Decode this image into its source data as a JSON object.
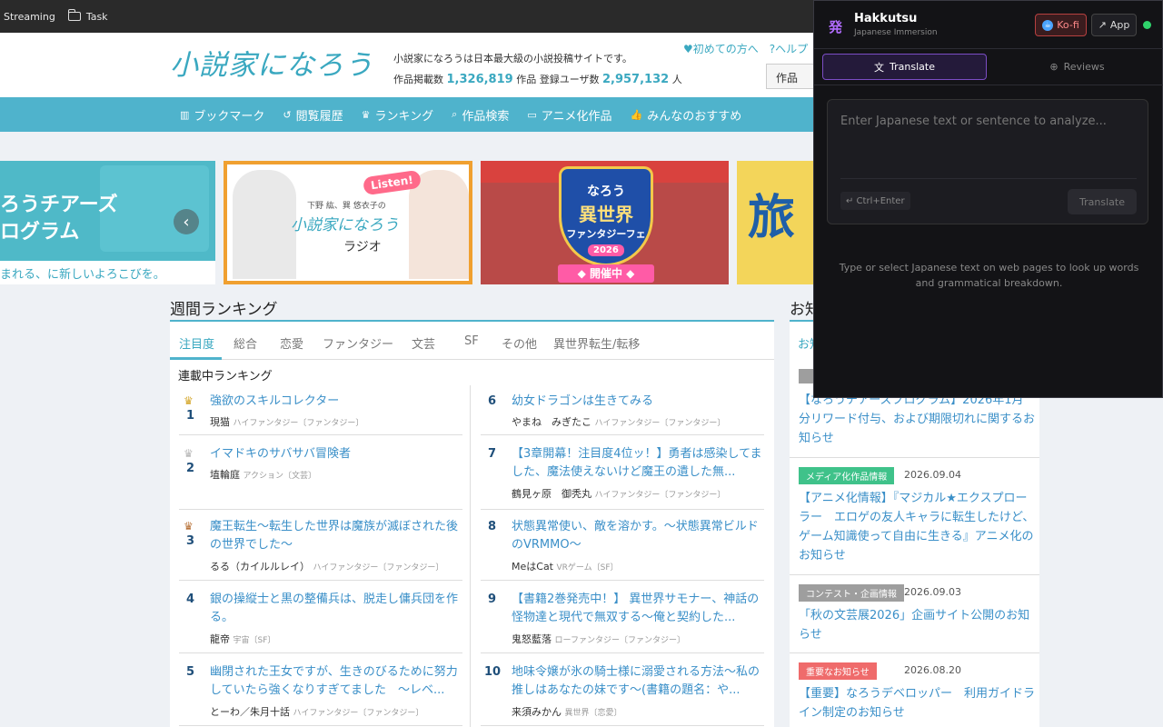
{
  "bookmarks": [
    {
      "label": "Streaming"
    },
    {
      "label": "Task"
    }
  ],
  "site": {
    "logo": "小説家になろう",
    "tagline": "小説家になろうは日本最大級の小説投稿サイトです。",
    "count_works_label": "作品掲載数",
    "count_works": "1,326,819",
    "count_works_unit": "作品",
    "count_users_label": "登録ユーザ数",
    "count_users": "2,957,132",
    "count_users_unit": "人",
    "link_first": "初めての方へ",
    "link_help": "ヘルプ",
    "search_select": "作品"
  },
  "nav": [
    {
      "icon": "▥",
      "label": "ブックマーク"
    },
    {
      "icon": "↺",
      "label": "閲覧履歴"
    },
    {
      "icon": "♛",
      "label": "ランキング"
    },
    {
      "icon": "⌕",
      "label": "作品検索"
    },
    {
      "icon": "▭",
      "label": "アニメ化作品"
    },
    {
      "icon": "👍",
      "label": "みんなのおすすめ"
    }
  ],
  "banners": {
    "b1_line1": "ろうチアーズ",
    "b1_line2": "ログラム",
    "b1_line3": "まれる、に新しいよろこびを。",
    "b2_listen": "Listen!",
    "b2_cap1": "下野 紘、巽 悠衣子の",
    "b2_cap2": "小説家になろう",
    "b2_cap3": "ラジオ",
    "b3_line1": "なろう",
    "b3_line2": "異世界",
    "b3_line3": "ファンタジーフェス!",
    "b3_year": "2026",
    "b3_status": "◆ 開催中 ◆",
    "b4_text": "旅"
  },
  "ranking": {
    "title": "週間ランキング",
    "tabs": [
      "注目度",
      "総合",
      "恋愛",
      "ファンタジー",
      "文芸",
      "SF",
      "その他",
      "異世界転生/転移"
    ],
    "subtitle": "連載中ランキング",
    "items": [
      {
        "rank": "1",
        "title": "強欲のスキルコレクター",
        "author": "現猫",
        "genre": "ハイファンタジー〔ファンタジー〕"
      },
      {
        "rank": "2",
        "title": "イマドキのサバサバ冒険者",
        "author": "埴輪庭",
        "genre": "アクション〔文芸〕"
      },
      {
        "rank": "3",
        "title": "魔王転生〜転生した世界は魔族が滅ぼされた後の世界でした〜",
        "author": "るる（カイルルレイ）",
        "genre": "ハイファンタジー〔ファンタジー〕"
      },
      {
        "rank": "4",
        "title": "銀の操縦士と黒の整備兵は、脱走し傭兵団を作る。",
        "author": "龍帝",
        "genre": "宇宙〔SF〕"
      },
      {
        "rank": "5",
        "title": "幽閉された王女ですが、生きのびるために努力していたら強くなりすぎてました　〜レベ...",
        "author": "とーわ／朱月十話",
        "genre": "ハイファンタジー〔ファンタジー〕"
      },
      {
        "rank": "6",
        "title": "幼女ドラゴンは生きてみる",
        "author": "やまね　みぎたこ",
        "genre": "ハイファンタジー〔ファンタジー〕"
      },
      {
        "rank": "7",
        "title": "【3章開幕！注目度4位ッ！】勇者は感染してました、魔法使えないけど魔王の遺した無...",
        "author": "鶴見ヶ原　御秃丸",
        "genre": "ハイファンタジー〔ファンタジー〕"
      },
      {
        "rank": "8",
        "title": "状態異常使い、敵を溶かす。〜状態異常ビルドのVRMMO〜",
        "author": "MeはCat",
        "genre": "VRゲーム〔SF〕"
      },
      {
        "rank": "9",
        "title": "【書籍2巻発売中！】 異世界サモナー、神話の怪物達と現代で無双する〜俺と契約した...",
        "author": "鬼怒藍落",
        "genre": "ローファンタジー〔ファンタジー〕"
      },
      {
        "rank": "10",
        "title": "地味令嬢が氷の騎士様に溺愛される方法〜私の推しはあなたの妹です〜(書籍の題名：や...",
        "author": "来須みかん",
        "genre": "異世界〔恋愛〕"
      }
    ]
  },
  "news": {
    "title": "お知",
    "tab": "お知",
    "items": [
      {
        "badge": "",
        "badge_color": "#9e9e9e",
        "date": "",
        "text": "【なろうチアーズプログラム】2026年1月分リワード付与、および期限切れに関するお知らせ"
      },
      {
        "badge": "メディア化作品情報",
        "badge_color": "#3fc28a",
        "date": "2026.09.04",
        "text": "【アニメ化情報】『マジカル★エクスプローラー　エロゲの友人キャラに転生したけど、ゲーム知識使って自由に生きる』アニメ化のお知らせ"
      },
      {
        "badge": "コンテスト・企画情報",
        "badge_color": "#9e9e9e",
        "date": "2026.09.03",
        "text": "「秋の文芸展2026」企画サイト公開のお知らせ"
      },
      {
        "badge": "重要なお知らせ",
        "badge_color": "#ef6b6b",
        "date": "2026.08.20",
        "text": "【重要】なろうデベロッパー　利用ガイドライン制定のお知らせ"
      }
    ]
  },
  "extension": {
    "logo": "発",
    "name": "Hakkutsu",
    "subtitle": "Japanese Immersion",
    "kofi": "Ko-fi",
    "app": "App",
    "tab_translate": "Translate",
    "tab_reviews": "Reviews",
    "input_placeholder": "Enter Japanese text or sentence to analyze...",
    "shortcut": "↵ Ctrl+Enter",
    "translate_button": "Translate",
    "help": "Type or select Japanese text on web pages to look up words and grammatical breakdown."
  }
}
